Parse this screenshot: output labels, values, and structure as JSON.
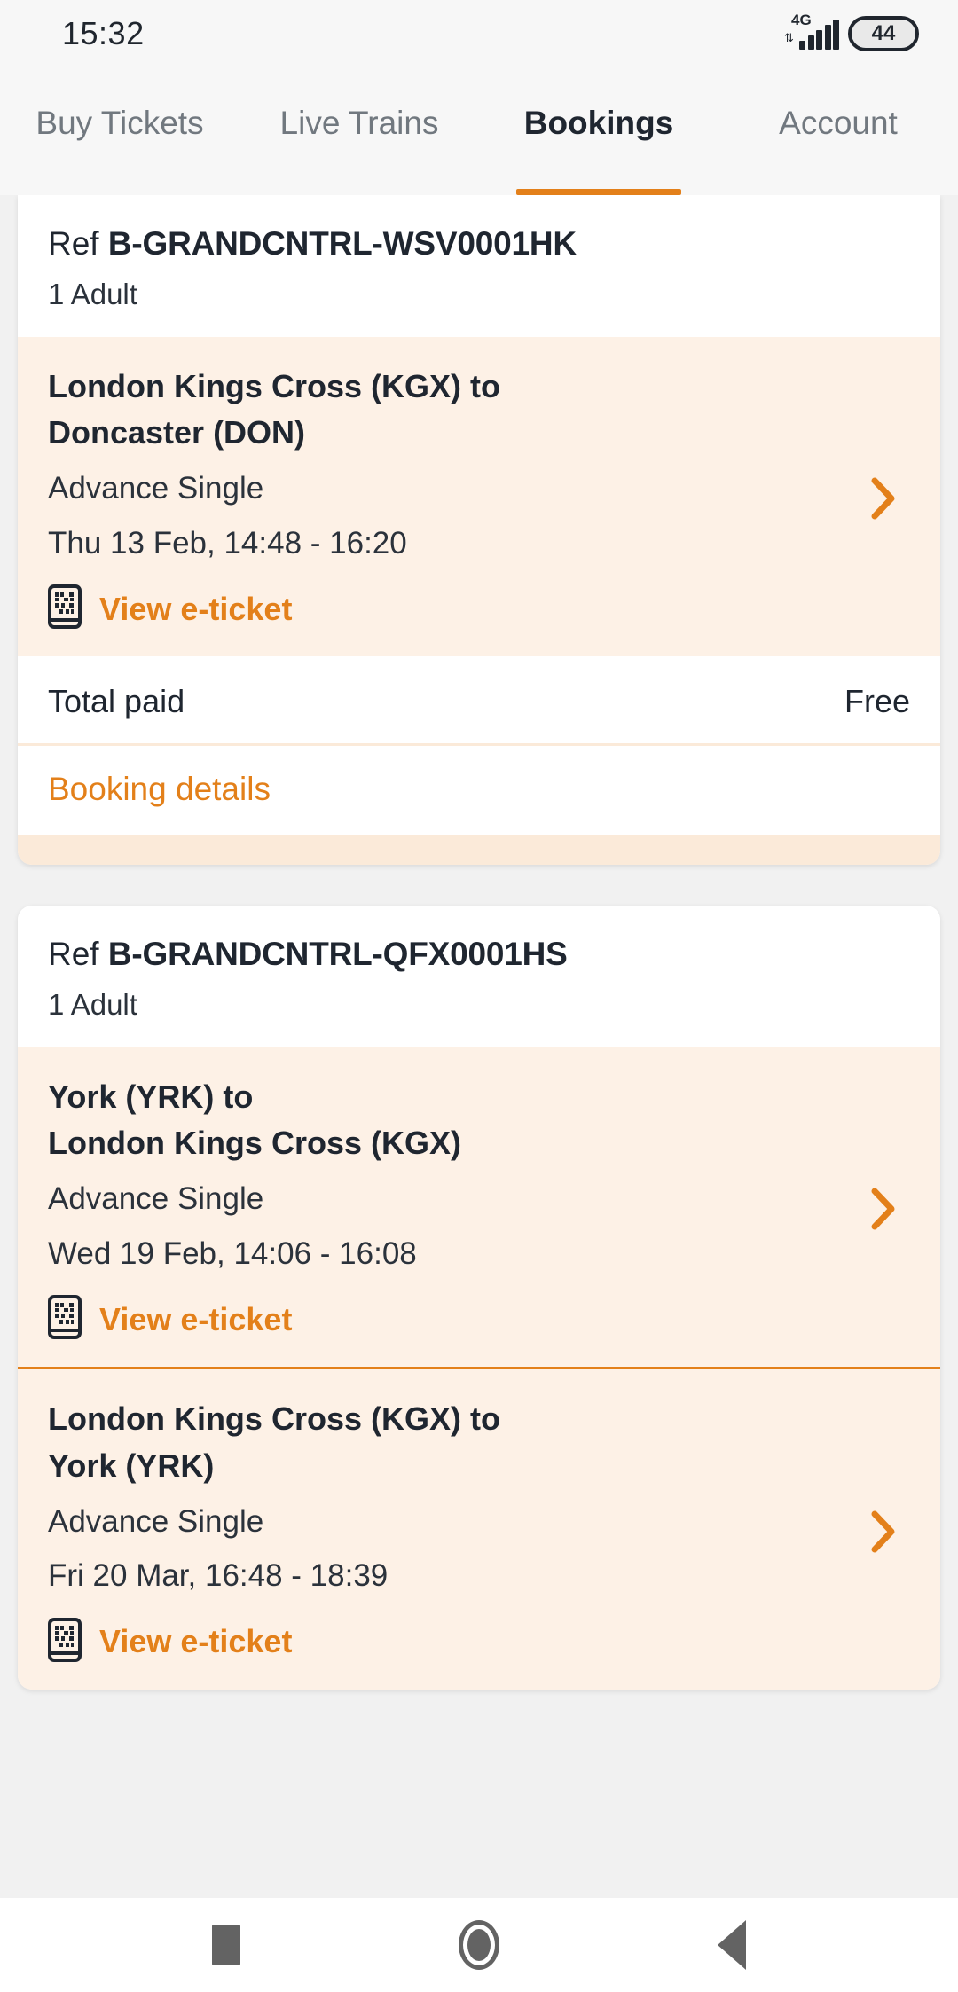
{
  "status_bar": {
    "time": "15:32",
    "network_type": "4G",
    "data_arrows_icon": "data-transfer-icon",
    "signal_icon": "signal-bars-icon",
    "battery_level": "44"
  },
  "tabs": [
    {
      "label": "Buy Tickets",
      "active": false
    },
    {
      "label": "Live Trains",
      "active": false
    },
    {
      "label": "Bookings",
      "active": true
    },
    {
      "label": "Account",
      "active": false
    }
  ],
  "accent_color": "#e3801a",
  "leg_bg_color": "#fdf1e6",
  "bookings": [
    {
      "ref_label": "Ref",
      "ref_code": "B-GRANDCNTRL-WSV0001HK",
      "passengers": "1 Adult",
      "legs": [
        {
          "route_line1": "London Kings Cross (KGX) to",
          "route_line2": "Doncaster (DON)",
          "fare": "Advance Single",
          "time": "Thu 13 Feb, 14:48 - 16:20",
          "eticket_label": "View e-ticket",
          "eticket_icon": "e-ticket-qr-icon",
          "chevron_icon": "chevron-right-icon"
        }
      ],
      "total_label": "Total paid",
      "total_value": "Free",
      "details_label": "Booking details"
    },
    {
      "ref_label": "Ref",
      "ref_code": "B-GRANDCNTRL-QFX0001HS",
      "passengers": "1 Adult",
      "legs": [
        {
          "route_line1": "York (YRK) to",
          "route_line2": "London Kings Cross (KGX)",
          "fare": "Advance Single",
          "time": "Wed 19 Feb, 14:06 - 16:08",
          "eticket_label": "View e-ticket",
          "eticket_icon": "e-ticket-qr-icon",
          "chevron_icon": "chevron-right-icon"
        },
        {
          "route_line1": "London Kings Cross (KGX) to",
          "route_line2": "York (YRK)",
          "fare": "Advance Single",
          "time": "Fri 20 Mar, 16:48 - 18:39",
          "eticket_label": "View e-ticket",
          "eticket_icon": "e-ticket-qr-icon",
          "chevron_icon": "chevron-right-icon"
        }
      ]
    }
  ],
  "navbar": {
    "recents_icon": "recents-square-icon",
    "home_icon": "home-circle-icon",
    "back_icon": "back-triangle-icon"
  }
}
